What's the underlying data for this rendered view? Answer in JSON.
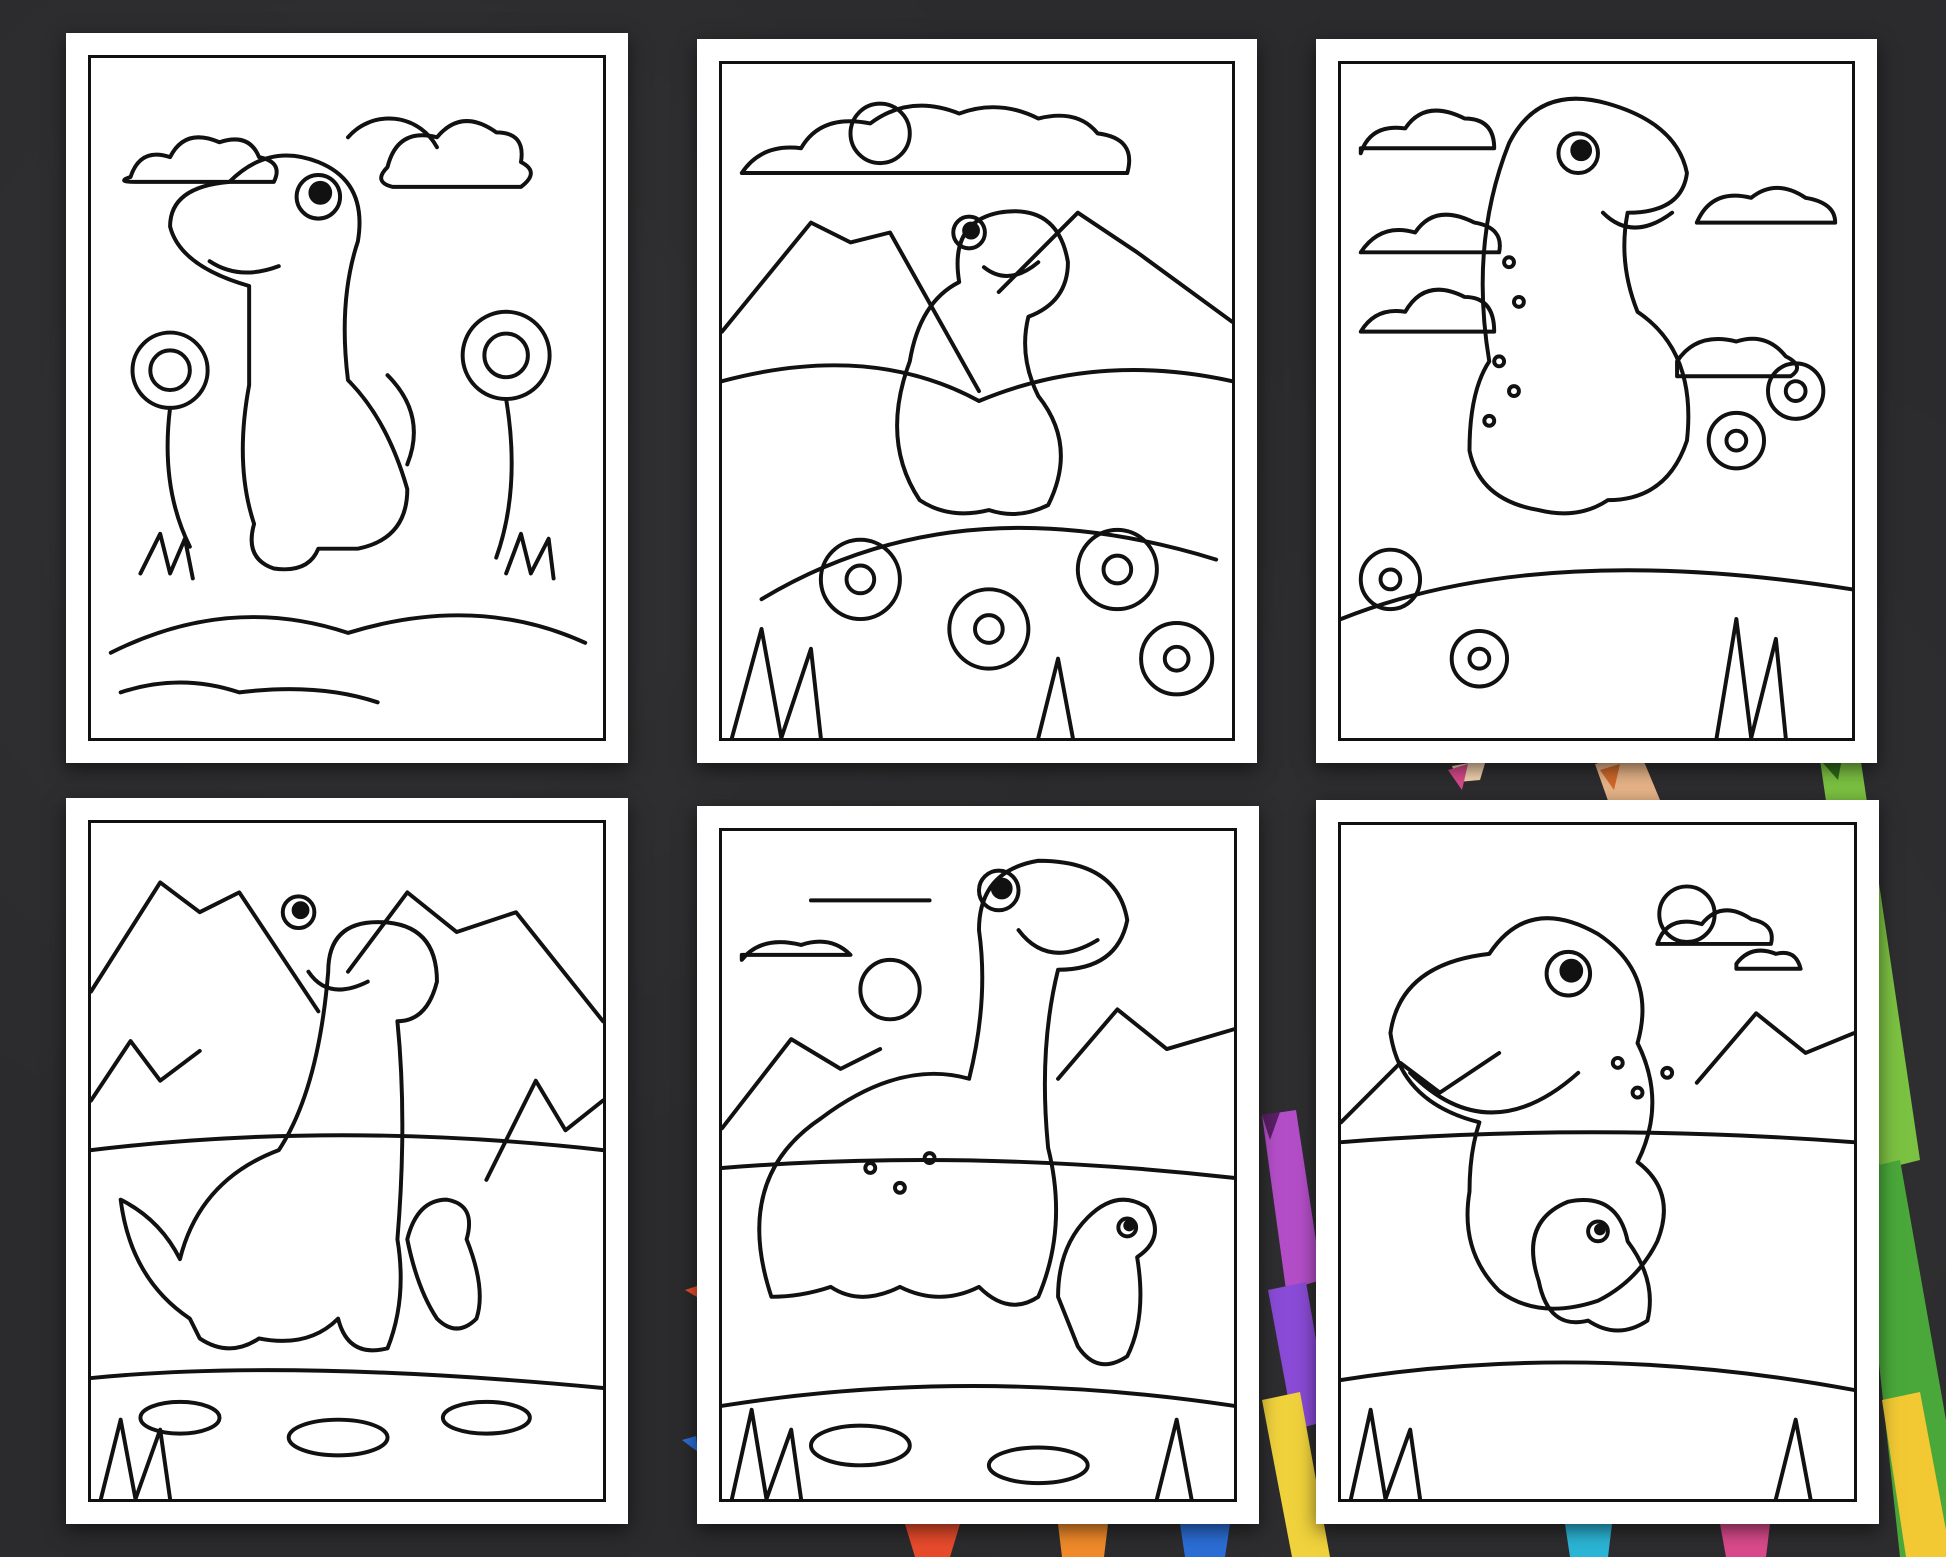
{
  "scene": {
    "background_color": "#2b2b2d",
    "page_color": "#ffffff",
    "line_color": "#111111"
  },
  "pages": [
    {
      "subject": "dinosaur-with-flowers"
    },
    {
      "subject": "dinosaur-on-hill-with-volcano"
    },
    {
      "subject": "spotted-dinosaur-with-clouds"
    },
    {
      "subject": "dinosaur-with-baby-by-lake"
    },
    {
      "subject": "long-neck-dinosaur-with-baby"
    },
    {
      "subject": "dinosaur-with-baby-and-sun"
    }
  ],
  "pencils": [
    {
      "color": "#d94a8c"
    },
    {
      "color": "#e8a06b"
    },
    {
      "color": "#7cc242"
    },
    {
      "color": "#4aa83a"
    },
    {
      "color": "#b44ec8"
    },
    {
      "color": "#8a4bd6"
    },
    {
      "color": "#f0d23c"
    },
    {
      "color": "#e84b2c"
    },
    {
      "color": "#2b6ed6"
    },
    {
      "color": "#f08a2a"
    },
    {
      "color": "#2bb5d6"
    }
  ]
}
